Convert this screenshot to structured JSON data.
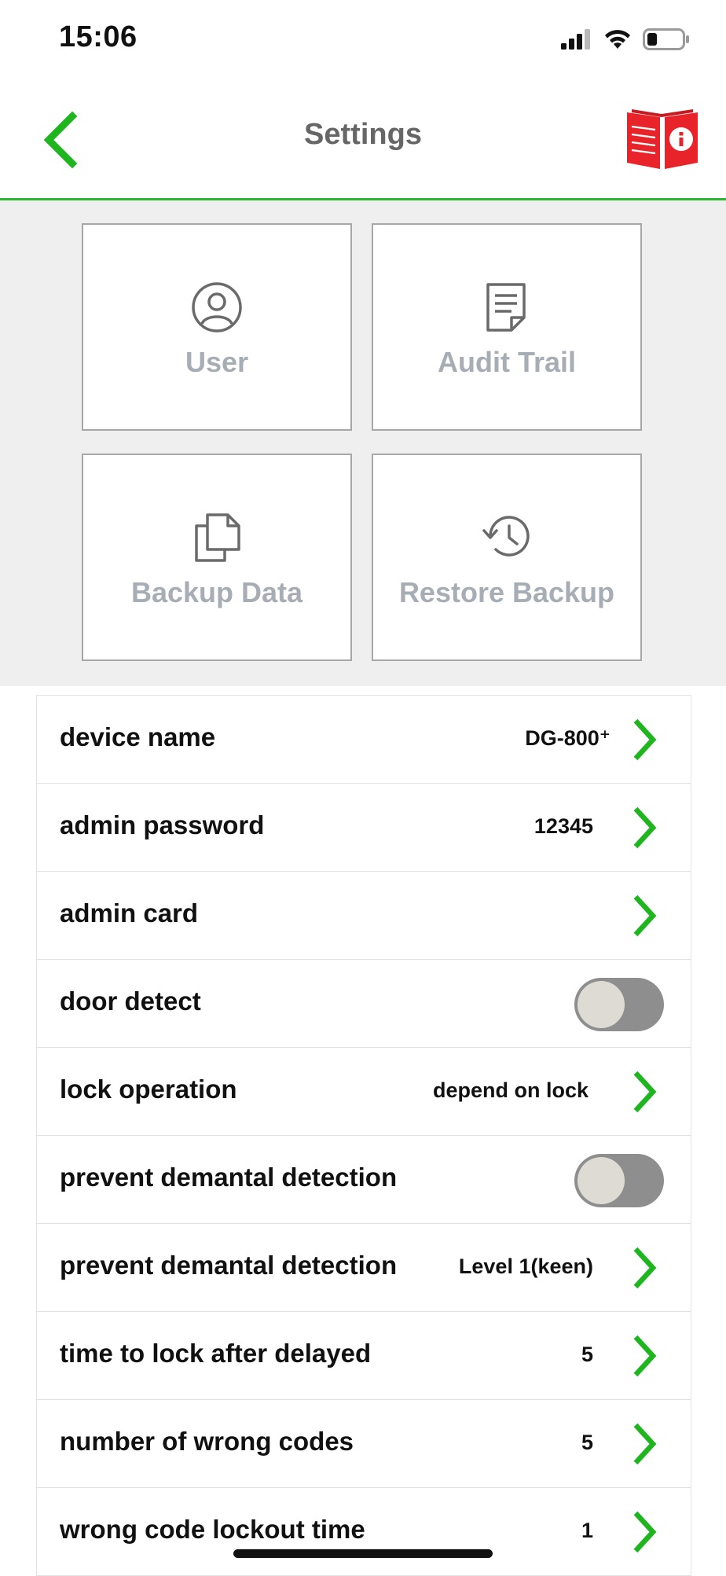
{
  "status": {
    "time": "15:06"
  },
  "header": {
    "title": "Settings"
  },
  "tiles": [
    {
      "label": "User",
      "icon": "user-icon"
    },
    {
      "label": "Audit Trail",
      "icon": "document-icon"
    },
    {
      "label": "Backup Data",
      "icon": "copy-icon"
    },
    {
      "label": "Restore Backup",
      "icon": "history-icon"
    }
  ],
  "settings": [
    {
      "label": "device name",
      "value": "DG-800⁺",
      "control": "chevron"
    },
    {
      "label": "admin password",
      "value": "12345",
      "control": "chevron"
    },
    {
      "label": "admin card",
      "value": "",
      "control": "chevron"
    },
    {
      "label": "door detect",
      "control": "toggle",
      "on": false
    },
    {
      "label": "lock operation",
      "value": "depend on lock",
      "control": "chevron"
    },
    {
      "label": "prevent demantal detection",
      "control": "toggle",
      "on": false
    },
    {
      "label": "prevent demantal detection",
      "value": "Level 1(keen)",
      "control": "chevron"
    },
    {
      "label": "time to lock after delayed",
      "value": "5",
      "control": "chevron"
    },
    {
      "label": "number of wrong codes",
      "value": "5",
      "control": "chevron"
    },
    {
      "label": "wrong code lockout time",
      "value": "1",
      "control": "chevron"
    }
  ],
  "colors": {
    "accent": "#2fb52f",
    "manual": "#e8232a",
    "tile_text": "#a7adb5",
    "toggle_off": "#8e8e8e"
  }
}
